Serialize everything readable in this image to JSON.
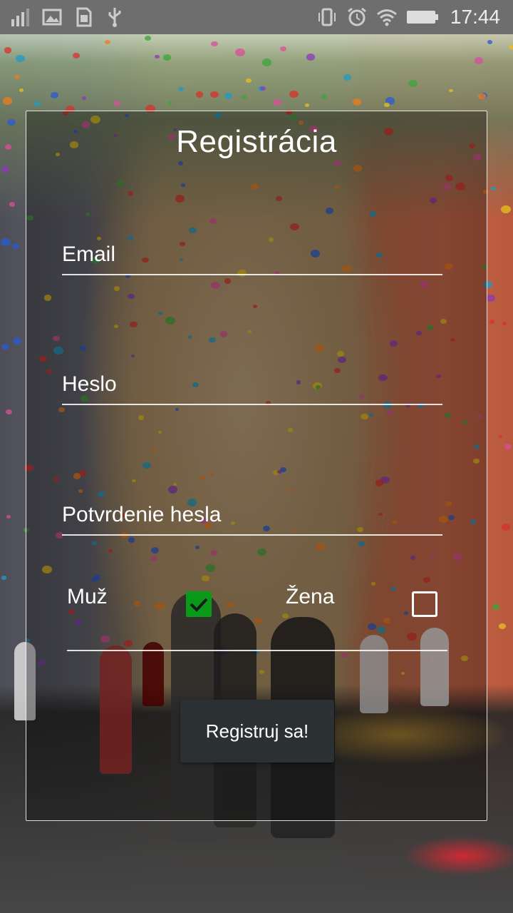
{
  "status_bar": {
    "time": "17:44",
    "icons": [
      "signal-icon",
      "image-icon",
      "sim-icon",
      "usb-icon",
      "vibrate-icon",
      "alarm-icon",
      "wifi-icon",
      "battery-icon"
    ]
  },
  "form": {
    "title": "Registrácia",
    "email_placeholder": "Email",
    "password_placeholder": "Heslo",
    "confirm_placeholder": "Potvrdenie hesla",
    "gender": {
      "male_label": "Muž",
      "female_label": "Žena",
      "male_checked": true,
      "female_checked": false
    },
    "submit_label": "Registruj sa!"
  },
  "colors": {
    "check_green": "#0a9a1a",
    "button_bg": "#2b3032",
    "status_bar_bg": "#6e6e6e"
  }
}
